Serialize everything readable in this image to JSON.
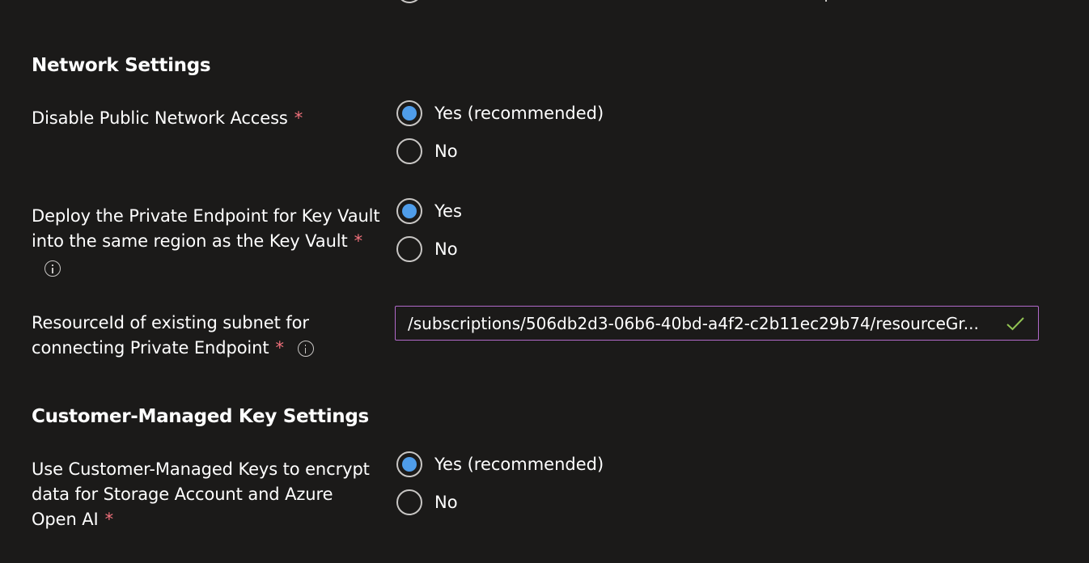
{
  "network_settings": {
    "title": "Network Settings",
    "disable_public_access": {
      "label": "Disable Public Network Access",
      "required_marker": "*",
      "options": [
        {
          "label": "Yes (recommended)",
          "checked": true
        },
        {
          "label": "No",
          "checked": false
        }
      ]
    },
    "private_endpoint_region": {
      "label_line1": "Deploy the Private Endpoint for Key Vault",
      "label_line2": "into the same region as the Key Vault",
      "required_marker": "*",
      "options": [
        {
          "label": "Yes",
          "checked": true
        },
        {
          "label": "No",
          "checked": false
        }
      ]
    },
    "subnet_resource_id": {
      "label_line1": "ResourceId of existing subnet for",
      "label_line2": "connecting Private Endpoint",
      "required_marker": "*",
      "value": "/subscriptions/506db2d3-06b6-40bd-a4f2-c2b11ec29b74/resourceGr..."
    }
  },
  "cmk_settings": {
    "title": "Customer-Managed Key Settings",
    "use_cmk": {
      "label_line1": "Use Customer-Managed Keys to encrypt",
      "label_line2": "data for Storage Account and Azure",
      "label_line3": "Open AI",
      "required_marker": "*",
      "options": [
        {
          "label": "Yes (recommended)",
          "checked": true
        },
        {
          "label": "No",
          "checked": false
        }
      ]
    }
  },
  "colors": {
    "background": "#1b1a19",
    "radio_selected": "#4f9dea",
    "required": "#f1707b",
    "field_border_focus": "#b169c9",
    "valid_check": "#92c353"
  }
}
